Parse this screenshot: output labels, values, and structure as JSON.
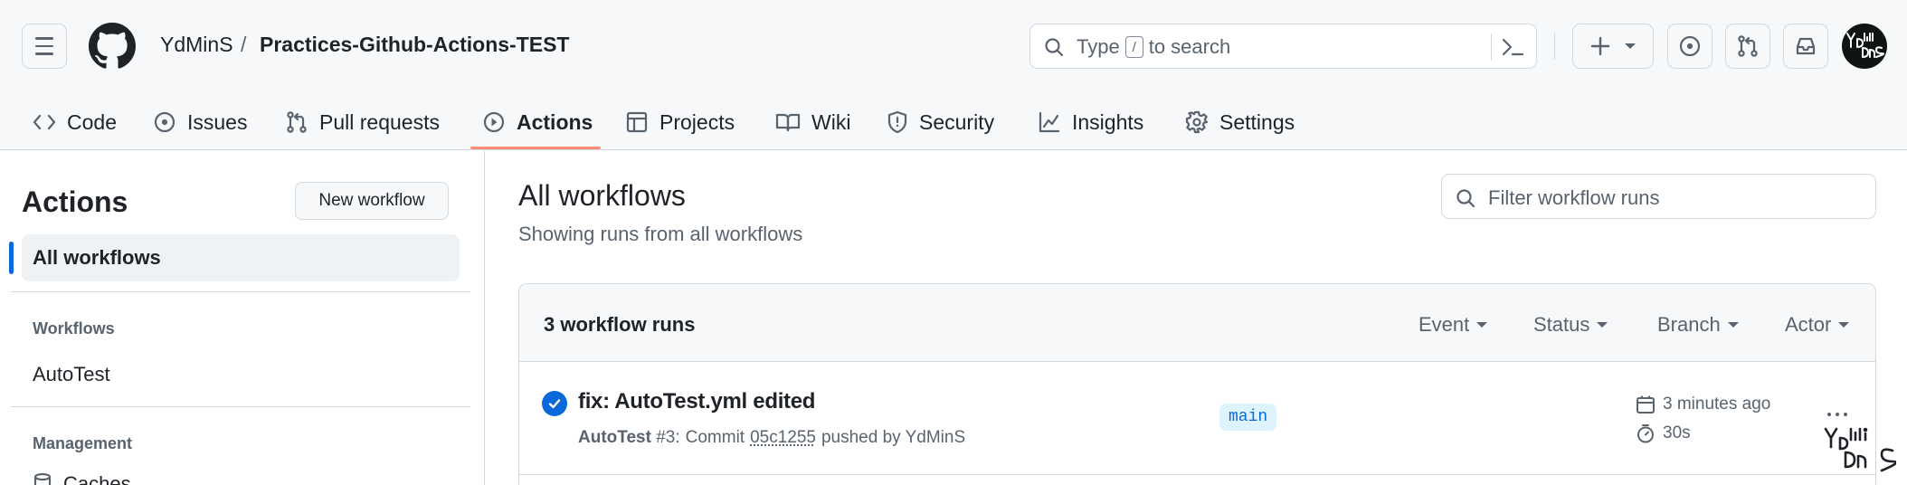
{
  "header": {
    "owner": "YdMinS",
    "separator": "/",
    "repo": "Practices-Github-Actions-TEST",
    "search": {
      "prefix": "Type",
      "key": "/",
      "suffix": "to search"
    }
  },
  "tabs": [
    {
      "label": "Code",
      "icon": "code-icon"
    },
    {
      "label": "Issues",
      "icon": "issue-opened-icon"
    },
    {
      "label": "Pull requests",
      "icon": "git-pull-request-icon"
    },
    {
      "label": "Actions",
      "icon": "play-icon",
      "selected": true
    },
    {
      "label": "Projects",
      "icon": "table-icon"
    },
    {
      "label": "Wiki",
      "icon": "book-icon"
    },
    {
      "label": "Security",
      "icon": "shield-icon"
    },
    {
      "label": "Insights",
      "icon": "graph-icon"
    },
    {
      "label": "Settings",
      "icon": "gear-icon"
    }
  ],
  "sidebar": {
    "title": "Actions",
    "new_workflow": "New workflow",
    "all_workflows": "All workflows",
    "workflows_heading": "Workflows",
    "workflows": [
      "AutoTest"
    ],
    "management_heading": "Management",
    "management_first": "Caches"
  },
  "main": {
    "title": "All workflows",
    "subtitle": "Showing runs from all workflows",
    "filter_placeholder": "Filter workflow runs",
    "runs_count": "3 workflow runs",
    "filters": [
      "Event",
      "Status",
      "Branch",
      "Actor"
    ],
    "runs": [
      {
        "title": "fix: AutoTest.yml edited",
        "workflow": "AutoTest",
        "run_number": "#3",
        "commit_label": "Commit",
        "sha": "05c1255",
        "pushed_by": "pushed by YdMinS",
        "branch": "main",
        "time": "3 minutes ago",
        "duration": "30s",
        "status": "success"
      }
    ]
  },
  "colors": {
    "accent": "#0969da",
    "nav_underline": "#fd8c73",
    "branch_bg": "#ddf4ff",
    "header_bg": "#f6f8fa"
  }
}
